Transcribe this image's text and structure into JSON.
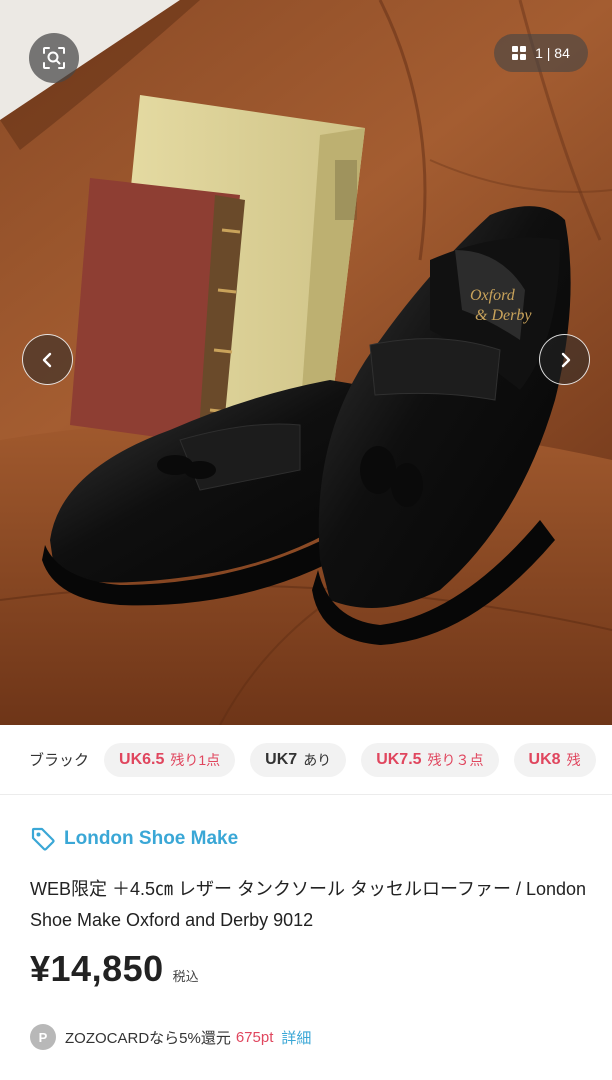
{
  "gallery": {
    "counter_text": "1 | 84",
    "current_index": 1,
    "total_images": 84,
    "image_subject": "black leather tassel loafers",
    "icons": {
      "lens": "image-search-icon",
      "grid": "grid-icon",
      "prev": "chevron-left-icon",
      "next": "chevron-right-icon"
    }
  },
  "sizes": {
    "color_label": "ブラック",
    "chips": [
      {
        "size": "UK6.5",
        "stock": "残り1点",
        "status": "low"
      },
      {
        "size": "UK7",
        "stock": "あり",
        "status": "ok"
      },
      {
        "size": "UK7.5",
        "stock": "残り３点",
        "status": "low"
      },
      {
        "size": "UK8",
        "stock": "残",
        "status": "low"
      }
    ]
  },
  "product": {
    "brand": "London Shoe Make",
    "title": "WEB限定 ＋4.5㎝ レザー タンクソール タッセルローファー / London Shoe Make Oxford and Derby 9012",
    "price": "¥14,850",
    "tax_label": "税込"
  },
  "points": {
    "badge": "P",
    "text": "ZOZOCARDなら5%還元",
    "amount": "675pt",
    "detail_link": "詳細"
  },
  "colors": {
    "brand_blue": "#3aa7d6",
    "alert_red": "#e0465e"
  }
}
